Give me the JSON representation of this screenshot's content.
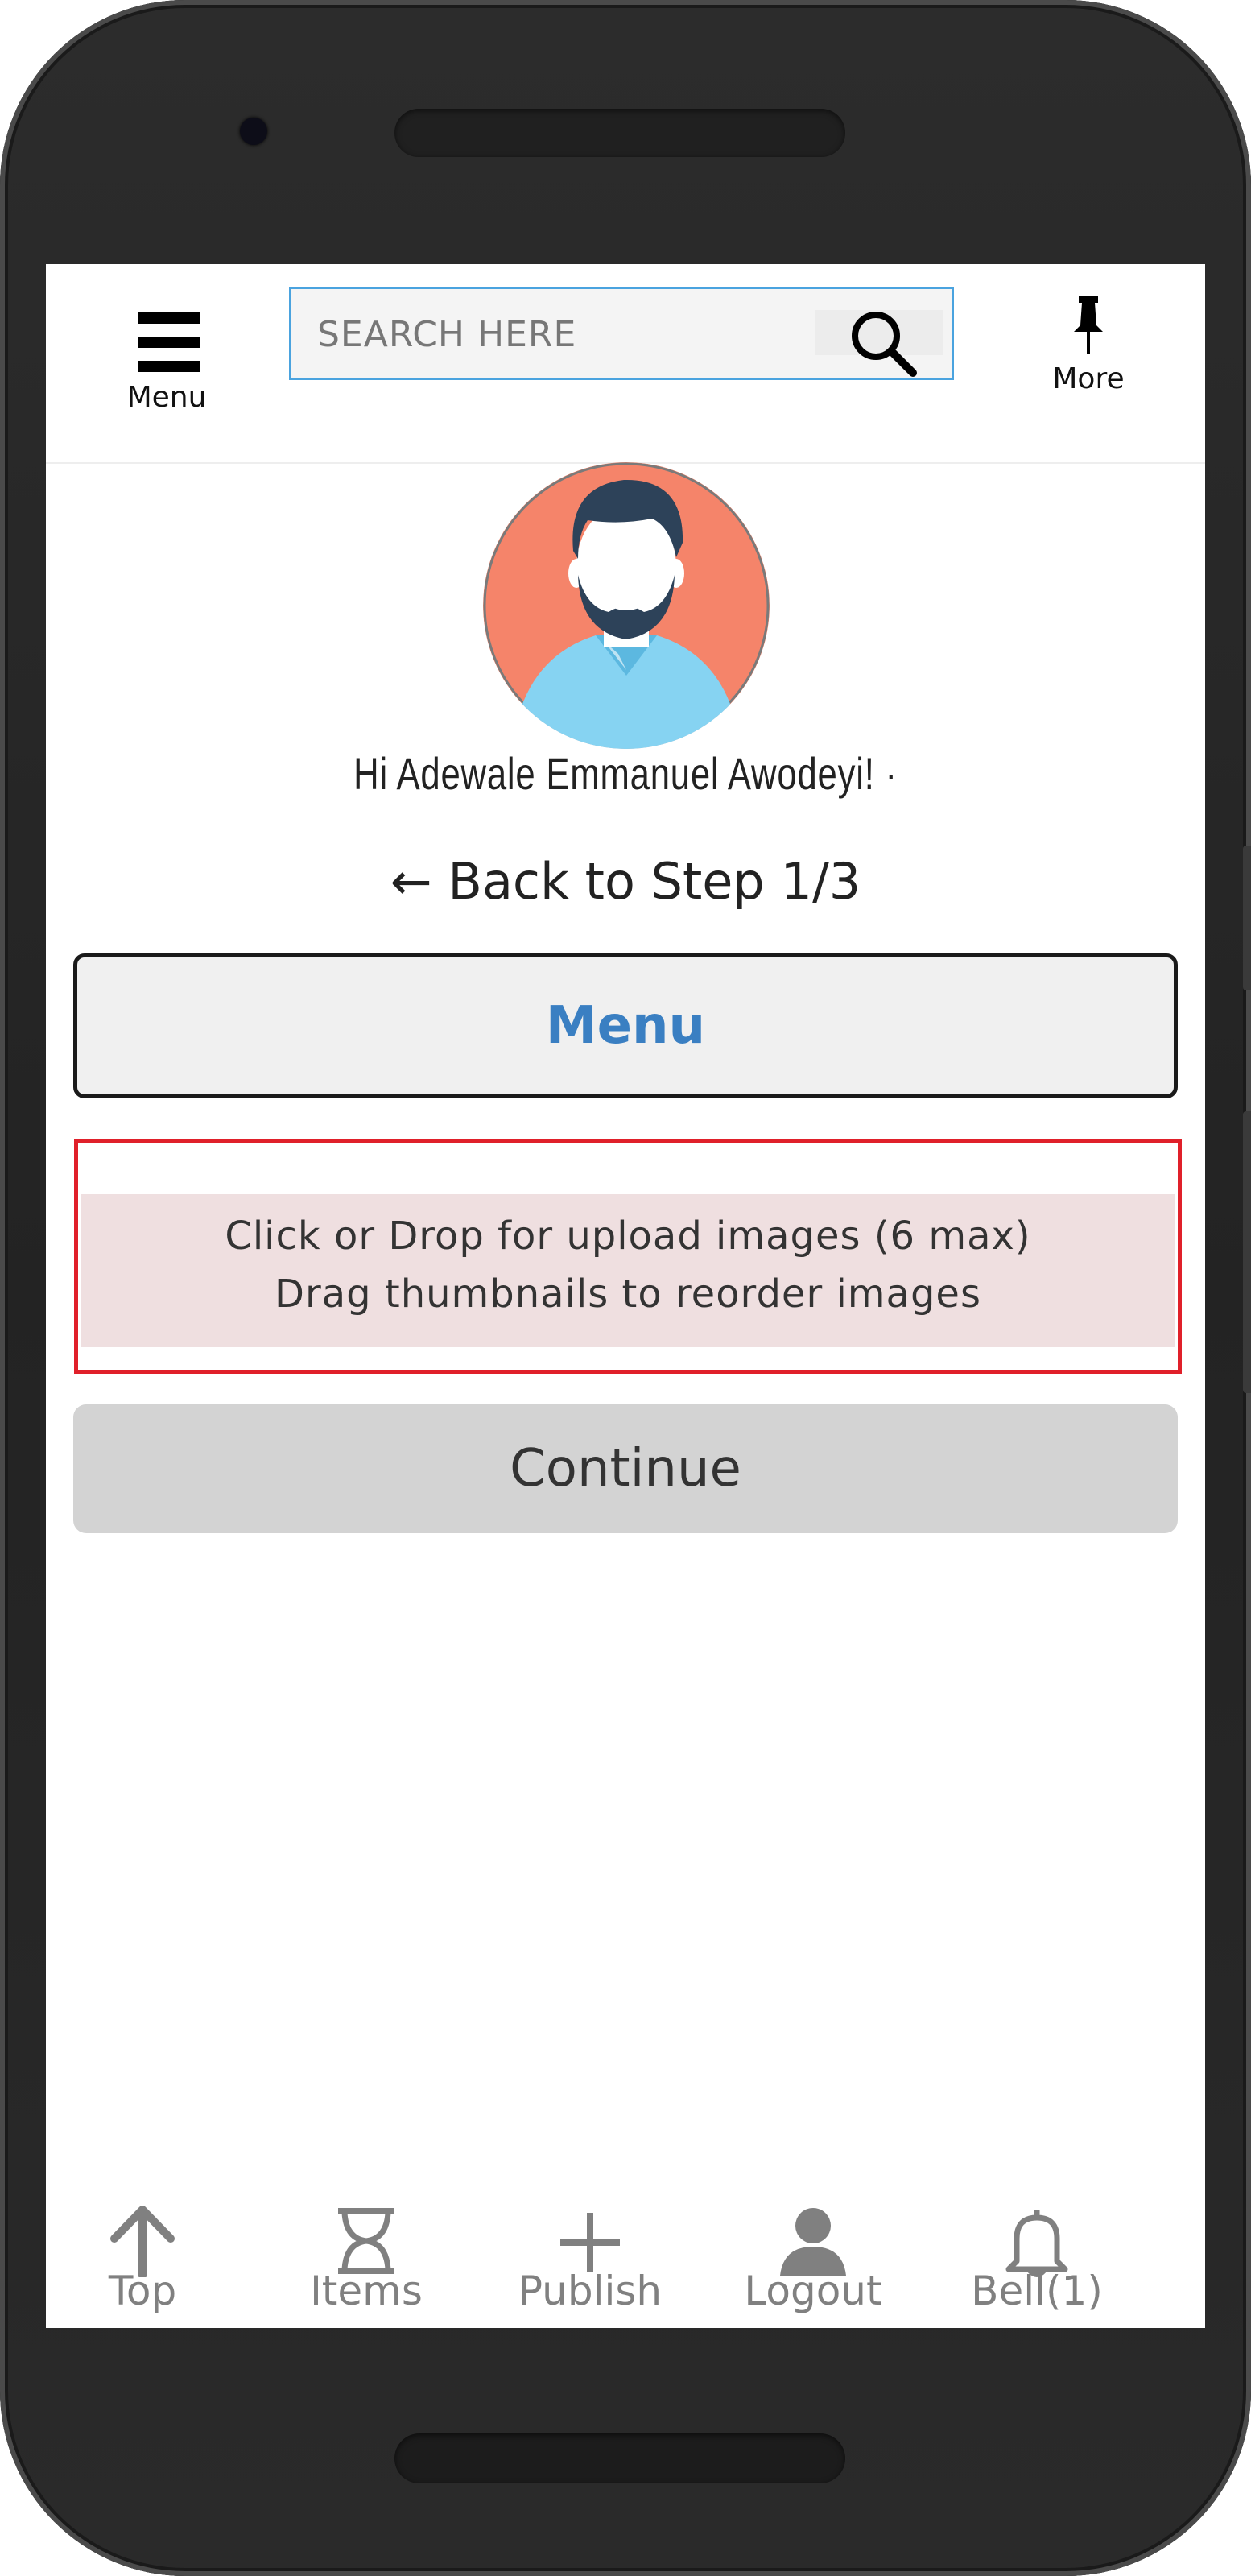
{
  "header": {
    "menu_label": "Menu",
    "search_placeholder": "SEARCH HERE",
    "more_label": "More"
  },
  "profile": {
    "greeting": "Hi Adewale Emmanuel Awodeyi! ·"
  },
  "step": {
    "back_link": "← Back to Step 1/3"
  },
  "menu_button": {
    "label": "Menu"
  },
  "upload": {
    "line1": "Click or Drop for upload images (6 max)",
    "line2": "Drag thumbnails to reorder images"
  },
  "continue_button": {
    "label": "Continue"
  },
  "bottom_nav": {
    "items": [
      {
        "label": "Top",
        "icon": "arrow-up-icon"
      },
      {
        "label": "Items",
        "icon": "hourglass-icon"
      },
      {
        "label": "Publish",
        "icon": "plus-icon"
      },
      {
        "label": "Logout",
        "icon": "user-icon"
      },
      {
        "label": "Bell(1)",
        "icon": "bell-icon"
      }
    ]
  },
  "colors": {
    "accent_blue": "#3a7fc2",
    "search_border": "#4aa3df",
    "upload_border": "#e0202a",
    "upload_fill": "#efdfe0",
    "continue_fill": "#d3d3d3",
    "nav_gray": "#808080"
  }
}
